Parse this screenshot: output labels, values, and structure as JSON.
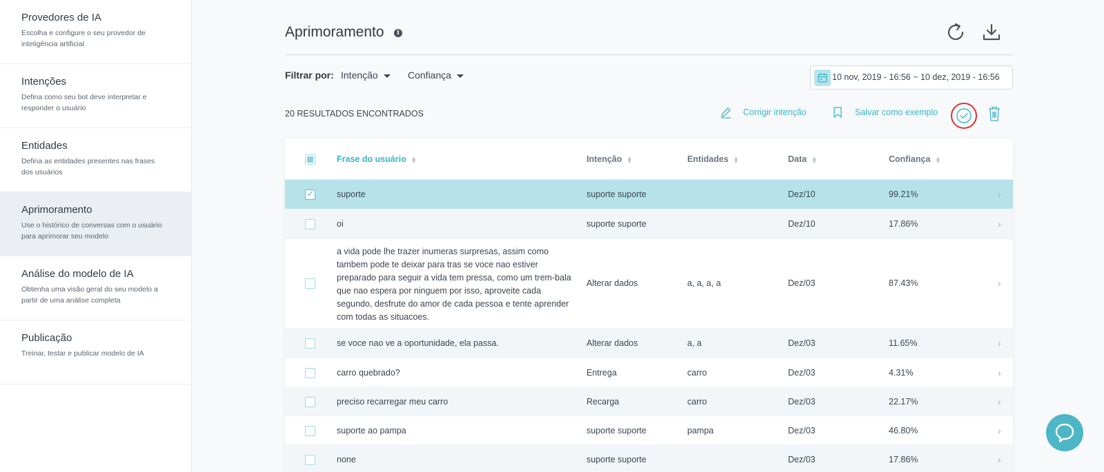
{
  "sidebar": {
    "items": [
      {
        "title": "Provedores de IA",
        "desc": "Escolha e configure o seu provedor de inteligência artificial"
      },
      {
        "title": "Intenções",
        "desc": "Defina como seu bot deve interpretar e responder o usuário"
      },
      {
        "title": "Entidades",
        "desc": "Defina as entidades presentes nas frases dos usuários"
      },
      {
        "title": "Aprimoramento",
        "desc": "Use o histórico de conversas com o usuário para aprimorar seu modelo",
        "active": true
      },
      {
        "title": "Análise do modelo de IA",
        "desc": "Obtenha uma visão geral do seu modelo a partir de uma análise completa"
      },
      {
        "title": "Publicação",
        "desc": "Treinar, testar e publicar modelo de IA"
      }
    ]
  },
  "header": {
    "title": "Aprimoramento"
  },
  "filters": {
    "label": "Filtrar por:",
    "intent": "Intenção",
    "confidence": "Confiança",
    "date_range": "10 nov, 2019 - 16:56 ~  10 dez, 2019 - 16:56"
  },
  "actions": {
    "results": "20 RESULTADOS ENCONTRADOS",
    "fix_intent": "Corrigir intenção",
    "save_example": "Salvar como exemplo"
  },
  "table": {
    "columns": [
      "Frase do usuário",
      "Intenção",
      "Entidades",
      "Data",
      "Confiança"
    ],
    "rows": [
      {
        "phrase": "suporte",
        "intent": "suporte suporte",
        "entities": "",
        "date": "Dez/10",
        "confidence": "99.21%",
        "selected": true
      },
      {
        "phrase": "oi",
        "intent": "suporte suporte",
        "entities": "",
        "date": "Dez/10",
        "confidence": "17.86%"
      },
      {
        "phrase": "a vida pode lhe trazer inumeras surpresas, assim como tambem pode te deixar para tras se voce nao estiver preparado para seguir a vida tem pressa, como um trem-bala que nao espera por ninguem por isso, aproveite cada segundo, desfrute do amor de cada pessoa e tente aprender com todas as situacoes.",
        "intent": "Alterar dados",
        "entities": "a, a, a, a",
        "date": "Dez/03",
        "confidence": "87.43%"
      },
      {
        "phrase": "se voce nao ve a oportunidade, ela passa.",
        "intent": "Alterar dados",
        "entities": "a, a",
        "date": "Dez/03",
        "confidence": "11.65%"
      },
      {
        "phrase": "carro quebrado?",
        "intent": "Entrega",
        "entities": "carro",
        "date": "Dez/03",
        "confidence": "4.31%"
      },
      {
        "phrase": "preciso recarregar meu carro",
        "intent": "Recarga",
        "entities": "carro",
        "date": "Dez/03",
        "confidence": "22.17%"
      },
      {
        "phrase": "suporte ao pampa",
        "intent": "suporte suporte",
        "entities": "pampa",
        "date": "Dez/03",
        "confidence": "46.80%"
      },
      {
        "phrase": "none",
        "intent": "suporte suporte",
        "entities": "",
        "date": "Dez/03",
        "confidence": "17.86%"
      }
    ]
  },
  "colors": {
    "accent": "#39b5c9",
    "selected_row": "#b6e2ea",
    "highlight_ring": "#e03030"
  }
}
